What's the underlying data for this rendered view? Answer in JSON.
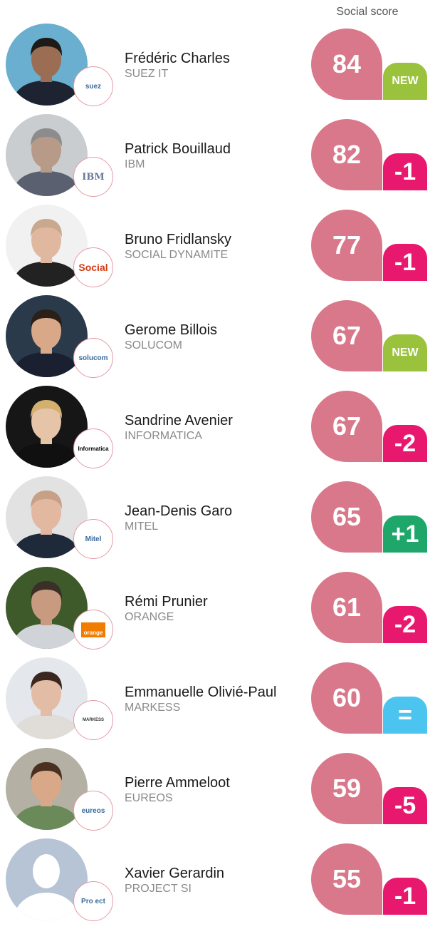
{
  "header": {
    "column_label": "Social score"
  },
  "colors": {
    "score_bg": "#d9788a",
    "new": "#9ac23c",
    "down": "#e8186e",
    "up": "#1fa66a",
    "same": "#4cc4f0"
  },
  "people": [
    {
      "name": "Frédéric Charles",
      "company": "SUEZ IT",
      "score": "84",
      "delta": "NEW",
      "delta_type": "new",
      "logo_text": "suez",
      "photo_bg": "#6aaed0",
      "skin": "#9b6d52",
      "hair": "#1e1a18",
      "shirt": "#1d2330"
    },
    {
      "name": "Patrick Bouillaud",
      "company": "IBM",
      "score": "82",
      "delta": "-1",
      "delta_type": "down",
      "logo_text": "IBM",
      "photo_bg": "#c9cdd0",
      "skin": "#b89a88",
      "hair": "#8c8c8c",
      "shirt": "#5a6070"
    },
    {
      "name": "Bruno Fridlansky",
      "company": "SOCIAL DYNAMITE",
      "score": "77",
      "delta": "-1",
      "delta_type": "down",
      "logo_text": "Social",
      "photo_bg": "#f1f1f1",
      "skin": "#e0b8a0",
      "hair": "#c9a890",
      "shirt": "#222222"
    },
    {
      "name": "Gerome Billois",
      "company": "SOLUCOM",
      "score": "67",
      "delta": "NEW",
      "delta_type": "new",
      "logo_text": "solucom",
      "photo_bg": "#2a3a4a",
      "skin": "#d9a888",
      "hair": "#2a2018",
      "shirt": "#1a2030"
    },
    {
      "name": "Sandrine Avenier",
      "company": "INFORMATICA",
      "score": "67",
      "delta": "-2",
      "delta_type": "down",
      "logo_text": "Informatica",
      "photo_bg": "#161616",
      "skin": "#e6c4a8",
      "hair": "#d4b070",
      "shirt": "#101010"
    },
    {
      "name": "Jean-Denis Garo",
      "company": "MITEL",
      "score": "65",
      "delta": "+1",
      "delta_type": "up",
      "logo_text": "Mitel",
      "photo_bg": "#e2e2e2",
      "skin": "#e2b8a0",
      "hair": "#c8a088",
      "shirt": "#1e2a3a"
    },
    {
      "name": "Rémi Prunier",
      "company": "ORANGE",
      "score": "61",
      "delta": "-2",
      "delta_type": "down",
      "logo_text": "orange",
      "photo_bg": "#3e5a2a",
      "skin": "#c89a80",
      "hair": "#3a3028",
      "shirt": "#d0d4d8"
    },
    {
      "name": "Emmanuelle Olivié-Paul",
      "company": "MARKESS",
      "score": "60",
      "delta": "=",
      "delta_type": "same",
      "logo_text": "MARKESS",
      "photo_bg": "#e4e8ec",
      "skin": "#e2bca4",
      "hair": "#3a2820",
      "shirt": "#e0dcd8"
    },
    {
      "name": "Pierre Ammeloot",
      "company": "EUREOS",
      "score": "59",
      "delta": "-5",
      "delta_type": "down",
      "logo_text": "eureos",
      "photo_bg": "#b4b0a4",
      "skin": "#d8a888",
      "hair": "#4a3020",
      "shirt": "#6a8a5a"
    },
    {
      "name": "Xavier Gerardin",
      "company": "PROJECT SI",
      "score": "55",
      "delta": "-1",
      "delta_type": "down",
      "logo_text": "Pro ect",
      "photo_bg": "#b6c4d6",
      "skin": "#ffffff",
      "hair": "#ffffff",
      "shirt": "#ffffff"
    }
  ]
}
